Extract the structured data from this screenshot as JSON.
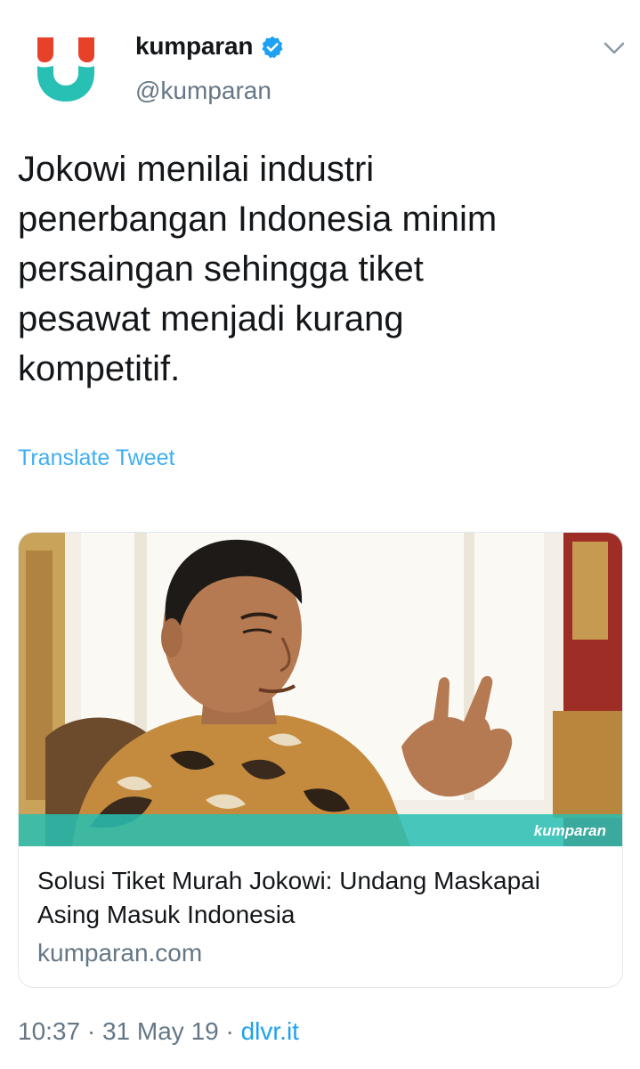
{
  "account": {
    "display_name": "kumparan",
    "handle": "@kumparan",
    "verified": true,
    "avatar_icon": "kumparan-logo",
    "menu_icon": "chevron-down-icon"
  },
  "tweet": {
    "lines": [
      "Jokowi menilai industri",
      "penerbangan Indonesia minim",
      "persaingan sehingga tiket",
      "pesawat menjadi kurang",
      "kompetitif."
    ],
    "translate_label": "Translate Tweet"
  },
  "card": {
    "image_watermark": "kumparan",
    "title_lines": [
      "Solusi Tiket Murah Jokowi: Undang Maskapai",
      "Asing Masuk Indonesia"
    ],
    "domain": "kumparan.com"
  },
  "meta": {
    "time": "10:37",
    "separator": " · ",
    "date": "31 May 19",
    "source": "dlvr.it"
  },
  "colors": {
    "brand_red": "#e8412a",
    "brand_teal": "#28c0b4",
    "link_blue": "#1da1f2",
    "muted_gray": "#657786",
    "text_dark": "#14171a"
  }
}
